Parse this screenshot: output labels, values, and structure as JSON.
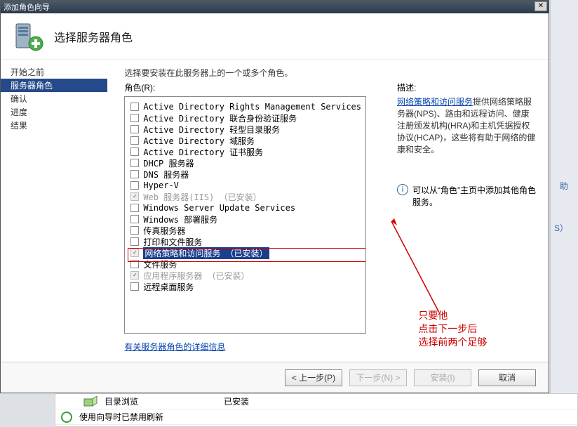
{
  "title_bar": "添加角色向导",
  "header_title": "选择服务器角色",
  "nav": {
    "items": [
      {
        "label": "开始之前"
      },
      {
        "label": "服务器角色"
      },
      {
        "label": "确认"
      },
      {
        "label": "进度"
      },
      {
        "label": "结果"
      }
    ],
    "selected_index": 1
  },
  "instruction": "选择要安装在此服务器上的一个或多个角色。",
  "roles_label": "角色(R):",
  "desc_label": "描述:",
  "roles": [
    {
      "label": "Active Directory Rights Management Services",
      "checked": false,
      "installed": false
    },
    {
      "label": "Active Directory 联合身份验证服务",
      "checked": false,
      "installed": false
    },
    {
      "label": "Active Directory 轻型目录服务",
      "checked": false,
      "installed": false
    },
    {
      "label": "Active Directory 域服务",
      "checked": false,
      "installed": false
    },
    {
      "label": "Active Directory 证书服务",
      "checked": false,
      "installed": false
    },
    {
      "label": "DHCP 服务器",
      "checked": false,
      "installed": false
    },
    {
      "label": "DNS 服务器",
      "checked": false,
      "installed": false
    },
    {
      "label": "Hyper-V",
      "checked": false,
      "installed": false
    },
    {
      "label": "Web 服务器(IIS) （已安装）",
      "checked": true,
      "installed": true
    },
    {
      "label": "Windows Server Update Services",
      "checked": false,
      "installed": false
    },
    {
      "label": "Windows 部署服务",
      "checked": false,
      "installed": false
    },
    {
      "label": "传真服务器",
      "checked": false,
      "installed": false
    },
    {
      "label": "打印和文件服务",
      "checked": false,
      "installed": false
    },
    {
      "label": "网络策略和访问服务 （已安装）",
      "checked": true,
      "installed": true,
      "selected": true
    },
    {
      "label": "文件服务",
      "checked": false,
      "installed": false
    },
    {
      "label": "应用程序服务器 （已安装）",
      "checked": true,
      "installed": true
    },
    {
      "label": "远程桌面服务",
      "checked": false,
      "installed": false
    }
  ],
  "more_link": "有关服务器角色的详细信息",
  "desc_link": "网络策略和访问服务",
  "desc_body": "提供网络策略服务器(NPS)、路由和远程访问、健康注册颁发机构(HRA)和主机凭据授权协议(HCAP)，这些将有助于网络的健康和安全。",
  "hint_text": "可以从“角色”主页中添加其他角色服务。",
  "annotation": {
    "line1": "只要他",
    "line2": "点击下一步后",
    "line3": "选择前两个足够"
  },
  "buttons": {
    "prev": "< 上一步(P)",
    "next": "下一步(N) >",
    "install": "安装(I)",
    "cancel": "取消"
  },
  "behind": {
    "row1_name": "目录浏览",
    "row1_status": "已安装",
    "row2_name": "使用向导时已禁用刷新"
  },
  "side_frag1": "助",
  "side_frag2": "S）"
}
